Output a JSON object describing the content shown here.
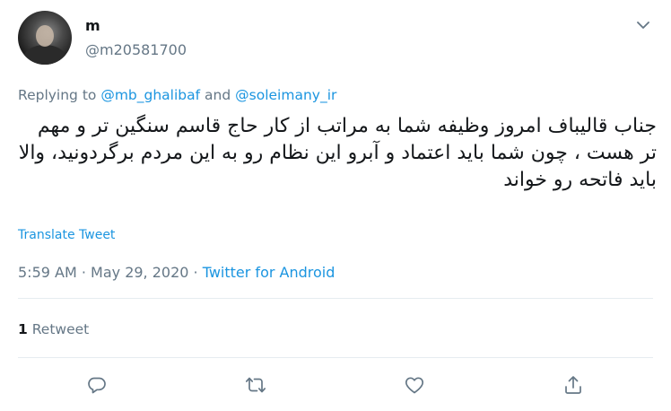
{
  "author": {
    "display_name": "m",
    "handle": "@m20581700"
  },
  "reply": {
    "prefix": "Replying to",
    "mention_1": "@mb_ghalibaf",
    "conjunction": "and",
    "mention_2": "@soleimany_ir"
  },
  "tweet": {
    "text": "جناب قالیباف امروز وظیفه شما به مراتب از کار حاج قاسم سنگین تر و مهم تر هست ، چون شما باید اعتماد و آبرو این نظام رو به این مردم برگردونید، والا باید فاتحه رو خواند",
    "translate_label": "Translate Tweet"
  },
  "meta": {
    "time": "5:59 AM",
    "separator_1": " · ",
    "date": "May 29, 2020",
    "separator_2": " · ",
    "source": "Twitter for Android"
  },
  "stats": {
    "retweet_count": "1",
    "retweet_label": "Retweet"
  },
  "actions": {
    "icons": [
      "reply-icon",
      "retweet-icon",
      "like-icon",
      "share-icon"
    ]
  },
  "colors": {
    "accent": "#1b95e0",
    "secondary_text": "#657786",
    "divider": "#e6ecf0",
    "icon": "#657786"
  }
}
